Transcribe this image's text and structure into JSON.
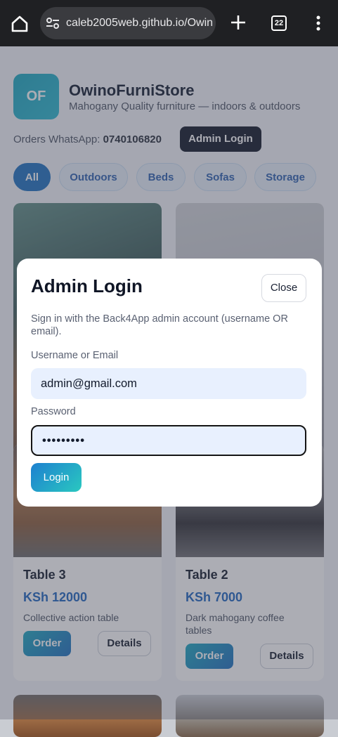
{
  "browser": {
    "url": "caleb2005web.github.io/Owin",
    "tab_count": "22"
  },
  "header": {
    "logo_text": "OF",
    "store_name": "OwinoFurniStore",
    "tagline": "Mahogany Quality furniture — indoors & outdoors",
    "orders_label": "Orders WhatsApp:",
    "whatsapp": "0740106820",
    "admin_button": "Admin Login"
  },
  "categories": [
    "All",
    "Outdoors",
    "Beds",
    "Sofas",
    "Storage"
  ],
  "products": [
    {
      "title": "Table 3",
      "price": "KSh 12000",
      "desc": "Collective action table",
      "order": "Order",
      "details": "Details"
    },
    {
      "title": "Table 2",
      "price": "KSh 7000",
      "desc": "Dark mahogany coffee tables",
      "order": "Order",
      "details": "Details"
    }
  ],
  "modal": {
    "title": "Admin Login",
    "close": "Close",
    "help": "Sign in with the Back4App admin account (username OR email).",
    "username_label": "Username or Email",
    "username_value": "admin@gmail.com",
    "password_label": "Password",
    "password_value": "•••••••••",
    "login": "Login"
  },
  "colors": {
    "accent": "#1d6fc0",
    "dark": "#0d1426",
    "browser_bar": "#1f2023"
  }
}
